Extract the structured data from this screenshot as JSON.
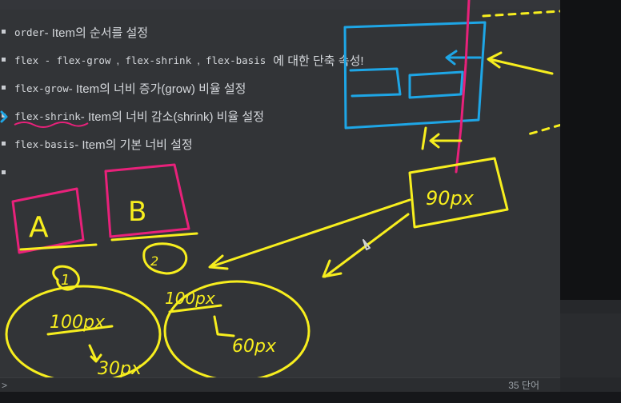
{
  "editor": {
    "items": [
      {
        "code": "order",
        "text": " - Item의 순서를 설정"
      },
      {
        "codes": [
          "flex - flex-grow",
          "flex-shrink",
          "flex-basis"
        ],
        "text": "에 대한 단축 속성!"
      },
      {
        "code": "flex-grow",
        "text": " - Item의 너비 증가(grow) 비율 설정"
      },
      {
        "code": "flex-shrink",
        "text": " - Item의 너비 감소(shrink) 비율 설정"
      },
      {
        "code": "flex-basis",
        "text": " - Item의 기본 너비 설정"
      }
    ],
    "separator": ","
  },
  "annotations": {
    "box_a": "A",
    "box_b": "B",
    "circle1_num": "1",
    "circle2_num": "2",
    "item1_value": "100px",
    "item1_result": "30px",
    "item2_value": "100px",
    "item2_result": "60px",
    "overflow_value": "90px"
  },
  "footer": {
    "left_icon": ">",
    "word_count": "35 단어"
  },
  "colors": {
    "pen_yellow": "#f7ee1e",
    "pen_pink": "#e8217a",
    "pen_blue": "#1ea6e6"
  }
}
